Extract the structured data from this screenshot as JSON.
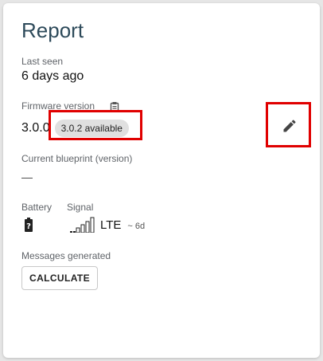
{
  "card": {
    "title": "Report"
  },
  "last_seen": {
    "label": "Last seen",
    "value": "6 days ago"
  },
  "firmware": {
    "label": "Firmware version",
    "current": "3.0.0",
    "available": "3.0.2 available",
    "copy_icon": "clipboard-icon",
    "edit_icon": "pencil-icon"
  },
  "blueprint": {
    "label": "Current blueprint (version)",
    "value": "—"
  },
  "battery": {
    "label": "Battery",
    "icon": "battery-unknown-icon"
  },
  "signal": {
    "label": "Signal",
    "icon": "signal-bars-icon",
    "network": "LTE",
    "age": "~ 6d"
  },
  "messages": {
    "label": "Messages generated",
    "button": "CALCULATE"
  },
  "colors": {
    "title": "#2d4a5a",
    "highlight": "#e00000",
    "chip_bg": "#e0e0e0"
  }
}
